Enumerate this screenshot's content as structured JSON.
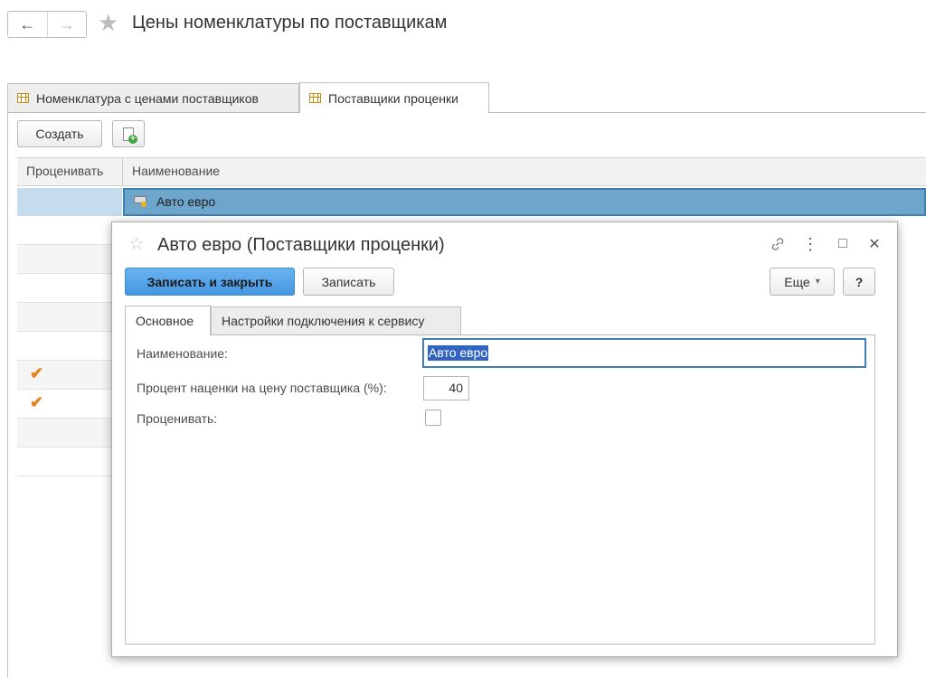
{
  "window": {
    "title": "Цены номенклатуры по поставщикам"
  },
  "nav": {
    "back_icon": "←",
    "forward_icon": "→",
    "favorite_icon": "★"
  },
  "main_tabs": [
    {
      "label": "Номенклатура с ценами поставщиков",
      "active": false
    },
    {
      "label": "Поставщики проценки",
      "active": true
    }
  ],
  "toolbar": {
    "create_label": "Создать",
    "new_doc_plus": "+"
  },
  "list": {
    "columns": [
      "Проценивать",
      "Наименование"
    ],
    "selected_row": {
      "name": "Авто евро"
    },
    "checks": [
      "✔",
      "✔"
    ]
  },
  "dialog": {
    "title": "Авто евро (Поставщики проценки)",
    "favorite_icon": "☆",
    "link_icon": "🔗",
    "menu_icon": "⋮",
    "maximize_icon": "□",
    "close_icon": "✕",
    "save_close_label": "Записать и закрыть",
    "save_label": "Записать",
    "more_label": "Еще",
    "more_arrow": "▾",
    "help_label": "?",
    "tabs": [
      {
        "label": "Основное",
        "active": true
      },
      {
        "label": "Настройки подключения к сервису",
        "active": false
      }
    ],
    "fields": {
      "name_label": "Наименование:",
      "name_value": "Авто евро",
      "markup_label": "Процент наценки на цену поставщика (%):",
      "markup_value": "40",
      "reprice_label": "Проценивать:",
      "reprice_checked": false
    }
  },
  "colors": {
    "accent": "#4596e0",
    "selection": "#6ea5cb",
    "check": "#e8811a"
  }
}
